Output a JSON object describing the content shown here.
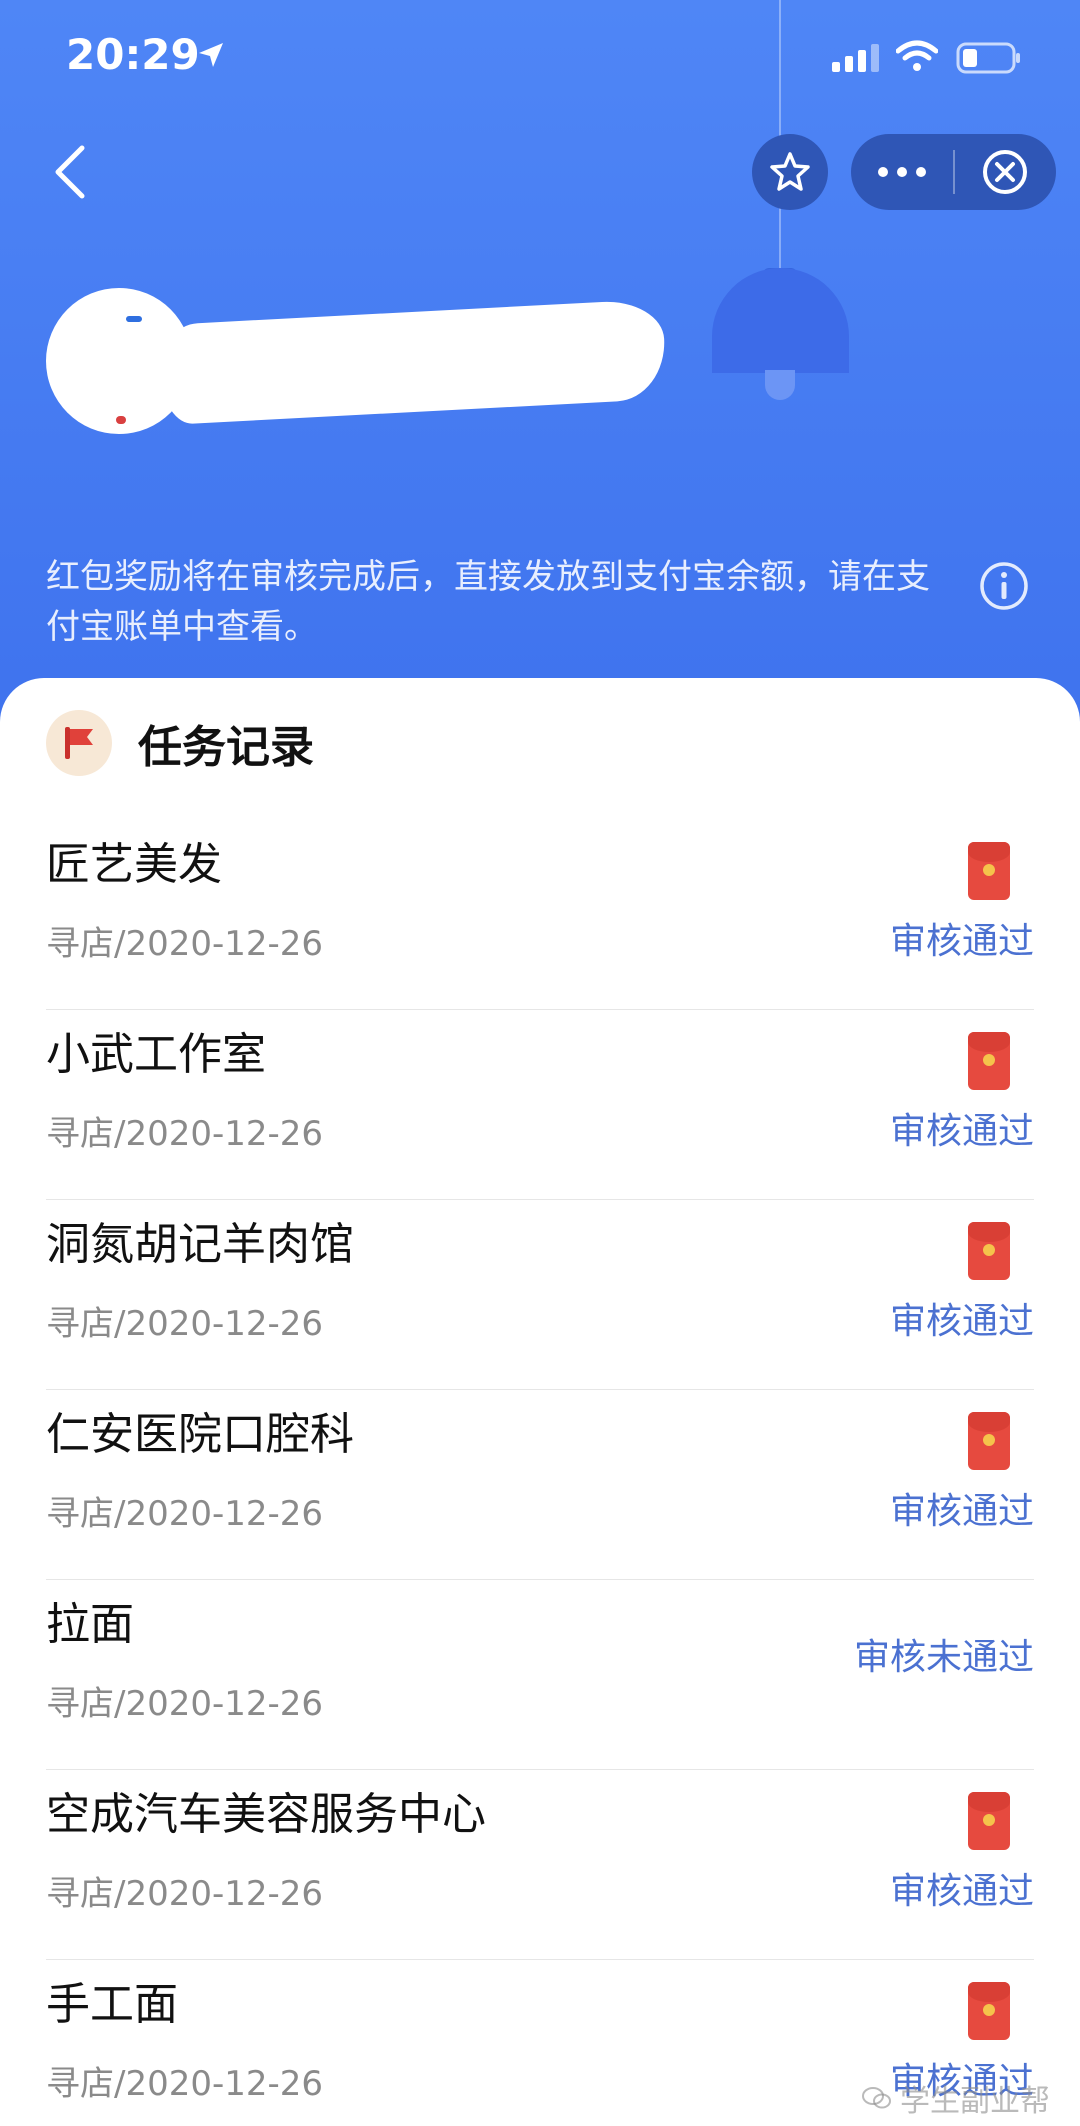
{
  "status_bar": {
    "time": "20:29"
  },
  "notice": {
    "text": "红包奖励将在审核完成后，直接发放到支付宝余额，请在支付宝账单中查看。"
  },
  "section": {
    "title": "任务记录"
  },
  "tasks": [
    {
      "name": "匠艺美发",
      "meta": "寻店/2020-12-26",
      "status": "审核通过",
      "has_redpacket": true
    },
    {
      "name": "小武工作室",
      "meta": "寻店/2020-12-26",
      "status": "审核通过",
      "has_redpacket": true
    },
    {
      "name": "洞氮胡记羊肉馆",
      "meta": "寻店/2020-12-26",
      "status": "审核通过",
      "has_redpacket": true
    },
    {
      "name": "仁安医院口腔科",
      "meta": "寻店/2020-12-26",
      "status": "审核通过",
      "has_redpacket": true
    },
    {
      "name": "拉面",
      "meta": "寻店/2020-12-26",
      "status": "审核未通过",
      "has_redpacket": false
    },
    {
      "name": "空成汽车美容服务中心",
      "meta": "寻店/2020-12-26",
      "status": "审核通过",
      "has_redpacket": true
    },
    {
      "name": "手工面",
      "meta": "寻店/2020-12-26",
      "status": "审核通过",
      "has_redpacket": true
    }
  ],
  "watermark": {
    "text": "学生副业帮"
  },
  "colors": {
    "header": "#4f84f3",
    "status_text": "#4b71d1",
    "redpacket": "#e64a3f"
  }
}
